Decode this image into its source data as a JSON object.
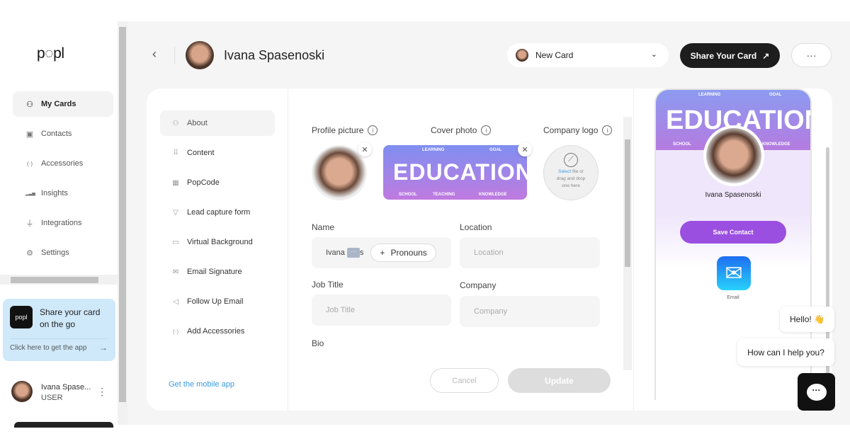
{
  "app": {
    "logo": "p◌pl"
  },
  "sidebar": {
    "items": [
      {
        "label": "My Cards",
        "icon": "user-icon",
        "glyph": "⚇"
      },
      {
        "label": "Contacts",
        "icon": "contacts-icon",
        "glyph": "▣"
      },
      {
        "label": "Accessories",
        "icon": "nfc-icon",
        "glyph": "(·)"
      },
      {
        "label": "Insights",
        "icon": "bar-chart-icon",
        "glyph": "▂▃▅"
      },
      {
        "label": "Integrations",
        "icon": "plug-icon",
        "glyph": "⏚"
      },
      {
        "label": "Settings",
        "icon": "gear-icon",
        "glyph": "⚙"
      }
    ],
    "promo": {
      "logo": "popl",
      "title": "Share your card on the go",
      "link": "Click here to get the app",
      "arrow": "→"
    },
    "user": {
      "name": "Ivana Spase...",
      "role": "USER",
      "menu": "⋮"
    }
  },
  "header": {
    "back": "‹",
    "name": "Ivana Spasenoski",
    "card_select": "New Card",
    "share_label": "Share Your Card",
    "share_icon": "↗",
    "more": "···"
  },
  "subnav": {
    "items": [
      {
        "label": "About",
        "glyph": "⚇"
      },
      {
        "label": "Content",
        "glyph": "⠿"
      },
      {
        "label": "PopCode",
        "glyph": "▦"
      },
      {
        "label": "Lead capture form",
        "glyph": "▽"
      },
      {
        "label": "Virtual Background",
        "glyph": "▭"
      },
      {
        "label": "Email Signature",
        "glyph": "✉"
      },
      {
        "label": "Follow Up Email",
        "glyph": "◁"
      },
      {
        "label": "Add Accessories",
        "glyph": "(·)"
      }
    ],
    "mobile_link": "Get the mobile app"
  },
  "form": {
    "profile_picture_label": "Profile picture",
    "cover_photo_label": "Cover photo",
    "company_logo_label": "Company logo",
    "cover_words": {
      "main": "EDUCATION",
      "a": "LEARNING",
      "b": "GOAL",
      "c": "SCHOOL",
      "d": "TEACHING",
      "e": "KNOWLEDGE"
    },
    "logo_drop": {
      "select": "Select",
      "rest1": " file or",
      "rest2": "drag and drop",
      "rest3": "one here"
    },
    "name_label": "Name",
    "name_value_start": "Ivana",
    "name_value_end": "s",
    "pronouns": "Pronouns",
    "location_label": "Location",
    "location_placeholder": "Location",
    "job_title_label": "Job Title",
    "job_title_placeholder": "Job Title",
    "company_label": "Company",
    "company_placeholder": "Company",
    "bio_label": "Bio",
    "cancel": "Cancel",
    "update": "Update"
  },
  "preview": {
    "name": "Ivana Spasenoski",
    "save_contact": "Save Contact",
    "email_label": "Email",
    "accent": "#9b4fe0"
  },
  "chat": {
    "hello": "Hello! 👋",
    "help": "How can I help you?"
  }
}
